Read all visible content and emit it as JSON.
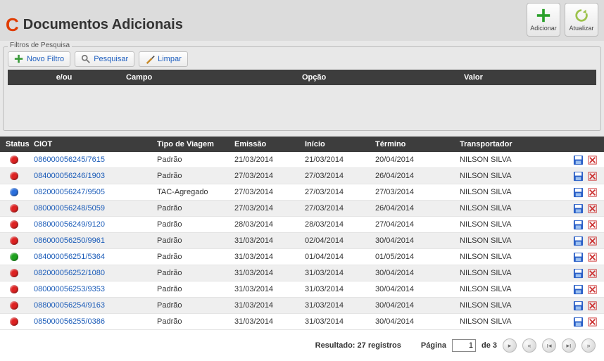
{
  "page_title": "Documentos Adicionais",
  "header_buttons": {
    "add": "Adicionar",
    "refresh": "Atualizar"
  },
  "filters": {
    "legend": "Filtros de Pesquisa",
    "new_filter": "Novo Filtro",
    "search": "Pesquisar",
    "clear": "Limpar",
    "columns": {
      "eou": "e/ou",
      "campo": "Campo",
      "opcao": "Opção",
      "valor": "Valor"
    }
  },
  "table": {
    "headers": {
      "status": "Status",
      "ciot": "CIOT",
      "tipo": "Tipo de Viagem",
      "emissao": "Emissão",
      "inicio": "Início",
      "termino": "Término",
      "transportador": "Transportador"
    },
    "status_colors": {
      "red": "#d22",
      "blue": "#2a6fdc",
      "green": "#1ea21e"
    },
    "rows": [
      {
        "status": "red",
        "ciot": "086000056245/7615",
        "tipo": "Padrão",
        "emissao": "21/03/2014",
        "inicio": "21/03/2014",
        "termino": "20/04/2014",
        "transportador": "NILSON SILVA"
      },
      {
        "status": "red",
        "ciot": "084000056246/1903",
        "tipo": "Padrão",
        "emissao": "27/03/2014",
        "inicio": "27/03/2014",
        "termino": "26/04/2014",
        "transportador": "NILSON SILVA"
      },
      {
        "status": "blue",
        "ciot": "082000056247/9505",
        "tipo": "TAC-Agregado",
        "emissao": "27/03/2014",
        "inicio": "27/03/2014",
        "termino": "27/03/2014",
        "transportador": "NILSON SILVA"
      },
      {
        "status": "red",
        "ciot": "080000056248/5059",
        "tipo": "Padrão",
        "emissao": "27/03/2014",
        "inicio": "27/03/2014",
        "termino": "26/04/2014",
        "transportador": "NILSON SILVA"
      },
      {
        "status": "red",
        "ciot": "088000056249/9120",
        "tipo": "Padrão",
        "emissao": "28/03/2014",
        "inicio": "28/03/2014",
        "termino": "27/04/2014",
        "transportador": "NILSON SILVA"
      },
      {
        "status": "red",
        "ciot": "086000056250/9961",
        "tipo": "Padrão",
        "emissao": "31/03/2014",
        "inicio": "02/04/2014",
        "termino": "30/04/2014",
        "transportador": "NILSON SILVA"
      },
      {
        "status": "green",
        "ciot": "084000056251/5364",
        "tipo": "Padrão",
        "emissao": "31/03/2014",
        "inicio": "01/04/2014",
        "termino": "01/05/2014",
        "transportador": "NILSON SILVA"
      },
      {
        "status": "red",
        "ciot": "082000056252/1080",
        "tipo": "Padrão",
        "emissao": "31/03/2014",
        "inicio": "31/03/2014",
        "termino": "30/04/2014",
        "transportador": "NILSON SILVA"
      },
      {
        "status": "red",
        "ciot": "080000056253/9353",
        "tipo": "Padrão",
        "emissao": "31/03/2014",
        "inicio": "31/03/2014",
        "termino": "30/04/2014",
        "transportador": "NILSON SILVA"
      },
      {
        "status": "red",
        "ciot": "088000056254/9163",
        "tipo": "Padrão",
        "emissao": "31/03/2014",
        "inicio": "31/03/2014",
        "termino": "30/04/2014",
        "transportador": "NILSON SILVA"
      },
      {
        "status": "red",
        "ciot": "085000056255/0386",
        "tipo": "Padrão",
        "emissao": "31/03/2014",
        "inicio": "31/03/2014",
        "termino": "30/04/2014",
        "transportador": "NILSON SILVA"
      }
    ]
  },
  "pager": {
    "result_prefix": "Resultado:",
    "result_count": "27 registros",
    "page_label": "Página",
    "current": "1",
    "of_label": "de 3"
  }
}
